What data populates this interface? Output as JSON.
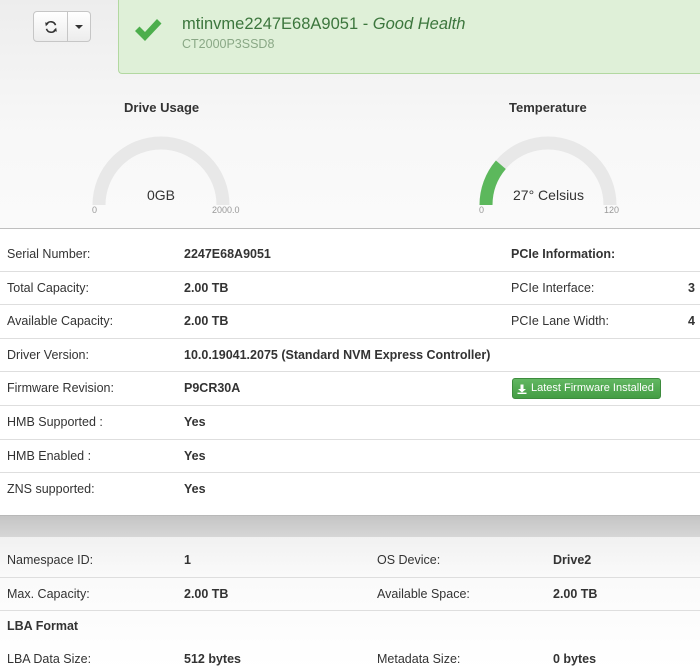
{
  "header": {
    "drive_name": "mtinvme2247E68A9051",
    "health_sep": " - ",
    "health_status": "Good Health",
    "model": "CT2000P3SSD8"
  },
  "colors": {
    "health_bg": "#dff0d8",
    "health_text": "#3c763d",
    "gauge_fill": "#5cb85c",
    "gauge_track": "#e8e8e8"
  },
  "gauges": {
    "usage": {
      "title": "Drive Usage",
      "value_label": "0GB",
      "min": "0",
      "max": "2000.0",
      "fraction": 0
    },
    "temperature": {
      "title": "Temperature",
      "value_label": "27° Celsius",
      "min": "0",
      "max": "120",
      "fraction": 0.225
    }
  },
  "details": {
    "serial_label": "Serial Number:",
    "serial_value": "2247E68A9051",
    "total_label": "Total Capacity:",
    "total_value": "2.00 TB",
    "available_label": "Available Capacity:",
    "available_value": "2.00 TB",
    "driver_label": "Driver Version:",
    "driver_value": "10.0.19041.2075 (Standard NVM Express Controller)",
    "firmware_label": "Firmware Revision:",
    "firmware_value": "P9CR30A",
    "firmware_button": "Latest Firmware Installed",
    "hmb_supported_label": "HMB Supported :",
    "hmb_supported_value": "Yes",
    "hmb_enabled_label": "HMB Enabled :",
    "hmb_enabled_value": "Yes",
    "zns_label": "ZNS supported:",
    "zns_value": "Yes"
  },
  "pcie": {
    "title": "PCIe Information:",
    "interface_label": "PCIe Interface:",
    "interface_value": "3",
    "lane_label": "PCIe Lane Width:",
    "lane_value": "4"
  },
  "namespace": {
    "id_label": "Namespace ID:",
    "id_value": "1",
    "os_label": "OS Device:",
    "os_value": "Drive2",
    "max_label": "Max. Capacity:",
    "max_value": "2.00 TB",
    "space_label": "Available Space:",
    "space_value": "2.00 TB",
    "lba_title": "LBA Format",
    "lba_size_label": "LBA Data Size:",
    "lba_size_value": "512 bytes",
    "meta_label": "Metadata Size:",
    "meta_value": "0 bytes"
  },
  "icons": {
    "refresh": "refresh-icon",
    "caret": "caret-down-icon",
    "check": "check-icon",
    "download": "download-icon"
  }
}
